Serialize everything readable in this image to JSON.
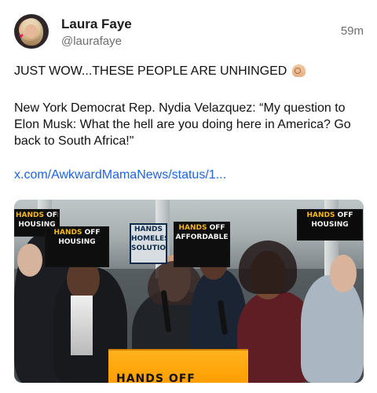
{
  "post": {
    "author_name": "Laura Faye",
    "author_handle": "@laurafaye",
    "time_ago": "59m",
    "text_line1": "JUST WOW...THESE PEOPLE ARE UNHINGED",
    "text_paragraph": "New York Democrat Rep. Nydia Velazquez: “My question to Elon Musk: What the hell are you doing here in America? Go back to South Africa!\"",
    "link_text": "x.com/AwkwardMamaNews/status/1..."
  },
  "media": {
    "signs": [
      {
        "line1": "HANDS",
        "line2": "OFF",
        "line3": "HOUSING"
      },
      {
        "line1": "HANDS",
        "line2": "OFF",
        "line3": "AFFORDABLE"
      },
      {
        "line1": "HANDS",
        "line2": "OFF",
        "line3": "HOMELESS"
      },
      {
        "line1": "HANDS",
        "line2": "OFF",
        "line3": "SOLUTIONS"
      }
    ],
    "podium_text": "HANDS OFF"
  },
  "colors": {
    "link": "#1e63e9",
    "muted_text": "#6d6d72",
    "sign_yellow": "#f4b71b",
    "podium_orange": "#ff9e00"
  },
  "icons": {
    "avatar_badge": "heart-icon",
    "emoji": "ok-hand-icon"
  }
}
